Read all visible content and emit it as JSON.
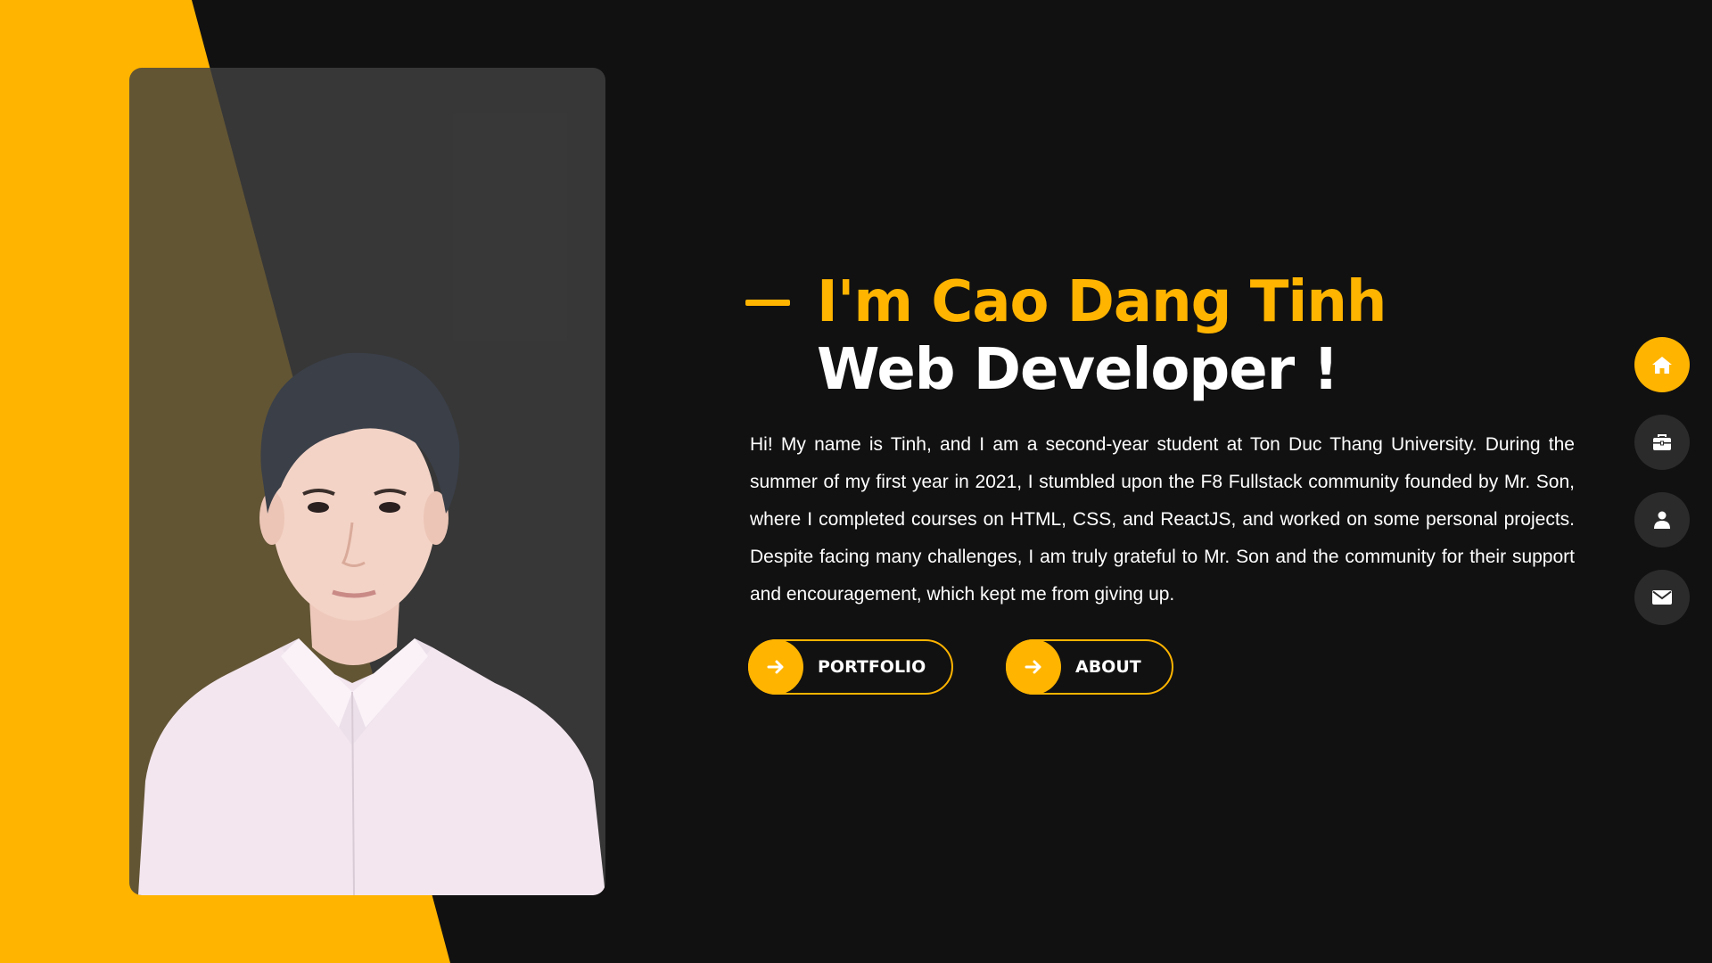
{
  "colors": {
    "accent": "#ffb400",
    "background": "#111111",
    "nav_inactive": "#2b2b2b",
    "text": "#ffffff"
  },
  "hero": {
    "name_line": "I'm Cao Dang Tinh",
    "role_line": "Web Developer !",
    "bio": "Hi! My name is Tinh, and I am a second-year student at Ton Duc Thang University. During the summer of my first year in 2021, I stumbled upon the F8 Fullstack community founded by Mr. Son, where I completed courses on HTML, CSS, and ReactJS, and worked on some personal projects. Despite facing many challenges, I am truly grateful to Mr. Son and the community for their support and encouragement, which kept me from giving up."
  },
  "buttons": {
    "portfolio_label": "PORTFOLIO",
    "about_label": "ABOUT",
    "icon": "arrow-right-icon"
  },
  "side_nav": {
    "items": [
      {
        "icon": "home-icon",
        "active": true
      },
      {
        "icon": "briefcase-icon",
        "active": false
      },
      {
        "icon": "user-icon",
        "active": false
      },
      {
        "icon": "envelope-icon",
        "active": false
      }
    ]
  }
}
